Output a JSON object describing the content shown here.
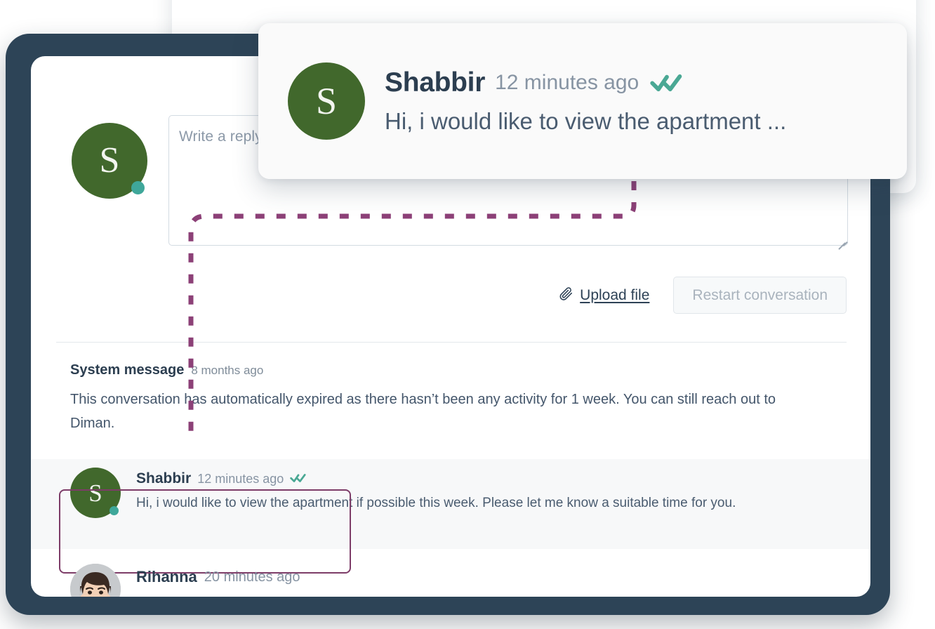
{
  "colors": {
    "frame": "#2d4457",
    "avatar_green": "#41682c",
    "status_teal": "#3fa79a",
    "check_teal": "#4aa894",
    "highlight_purple": "#7d3c68",
    "connector_purple": "#8c4077",
    "text_dark": "#2c3e50",
    "text_muted": "#8794a3",
    "row_bg": "#f7f8f9"
  },
  "composer": {
    "avatar": {
      "initial": "S",
      "status": "online"
    },
    "reply_placeholder": "Write a reply",
    "reply_value": "",
    "upload_label": "Upload file",
    "restart_label": "Restart conversation"
  },
  "system_message": {
    "title": "System message",
    "time": "8 months ago",
    "body": "This conversation has automatically expired as there hasn’t been any activity for 1 week. You can still reach out to Diman."
  },
  "messages": [
    {
      "avatar_initial": "S",
      "author": "Shabbir",
      "time": "12 minutes ago",
      "read_receipt": "double-check",
      "text": "Hi, i would like to view the apartment if possible this week. Please let me know a suitable time for you.",
      "highlighted": true
    },
    {
      "avatar_initial": "",
      "author": "Rihanna",
      "time": "20 minutes ago",
      "read_receipt": "",
      "text": "",
      "highlighted": false
    }
  ],
  "notification": {
    "avatar_initial": "S",
    "author": "Shabbir",
    "time": "12 minutes ago",
    "read_receipt": "double-check",
    "preview": "Hi, i would like to view the apartment ..."
  }
}
